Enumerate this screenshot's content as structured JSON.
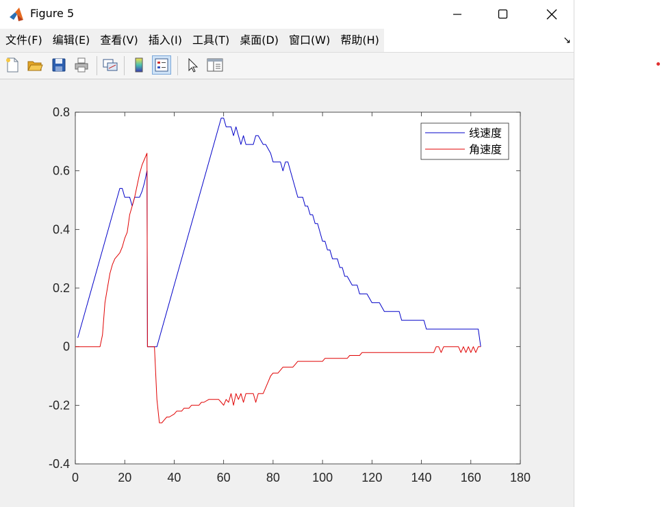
{
  "window": {
    "title": "Figure 5",
    "icon": "matlab-logo-icon",
    "controls": [
      "minimize-icon",
      "maximize-icon",
      "close-icon"
    ]
  },
  "menu": {
    "items": [
      {
        "label": "文件(F)"
      },
      {
        "label": "编辑(E)"
      },
      {
        "label": "查看(V)"
      },
      {
        "label": "插入(I)"
      },
      {
        "label": "工具(T)"
      },
      {
        "label": "桌面(D)"
      },
      {
        "label": "窗口(W)"
      },
      {
        "label": "帮助(H)"
      }
    ],
    "dock_glyph": "↘"
  },
  "toolbar": {
    "buttons": [
      {
        "icon": "new-figure-icon"
      },
      {
        "icon": "open-file-icon"
      },
      {
        "icon": "save-icon"
      },
      {
        "icon": "print-icon"
      },
      {
        "icon": "link-plot-icon"
      },
      {
        "icon": "colorbar-icon"
      },
      {
        "icon": "legend-icon",
        "active": true
      },
      {
        "icon": "pointer-icon"
      },
      {
        "icon": "property-editor-icon"
      }
    ]
  },
  "chart_data": {
    "type": "line",
    "title": "",
    "xlabel": "",
    "ylabel": "",
    "xlim": [
      0,
      180
    ],
    "ylim": [
      -0.4,
      0.8
    ],
    "xticks": [
      0,
      20,
      40,
      60,
      80,
      100,
      120,
      140,
      160,
      180
    ],
    "xtick_labels": [
      "0",
      "20",
      "40",
      "60",
      "80",
      "100",
      "120",
      "140",
      "160",
      "180"
    ],
    "yticks": [
      -0.4,
      -0.2,
      0,
      0.2,
      0.4,
      0.6,
      0.8
    ],
    "ytick_labels": [
      "-0.4",
      "-0.2",
      "0",
      "0.2",
      "0.4",
      "0.6",
      "0.8"
    ],
    "grid": false,
    "legend_position": "top-right",
    "series": [
      {
        "name": "线速度",
        "color": "#0000c8",
        "x": [
          1,
          18,
          19,
          20,
          22,
          23,
          24,
          25,
          26,
          27,
          28,
          29,
          29.2,
          32,
          33,
          59,
          60,
          61,
          62,
          63,
          64,
          65,
          66,
          67,
          68,
          69,
          70,
          72,
          73,
          74,
          76,
          77,
          79,
          80,
          82,
          83,
          84,
          85,
          86,
          87,
          88,
          89,
          90,
          91,
          92,
          93,
          94,
          95,
          96,
          97,
          98,
          99,
          100,
          101,
          102,
          103,
          104,
          105,
          106,
          107,
          108,
          109,
          110,
          112,
          113,
          114,
          115,
          116,
          117,
          118,
          120,
          121,
          122,
          123,
          125,
          126,
          128,
          131,
          132,
          135,
          136,
          141,
          142,
          147,
          148,
          163,
          164
        ],
        "y": [
          0.03,
          0.54,
          0.54,
          0.51,
          0.51,
          0.48,
          0.51,
          0.51,
          0.51,
          0.53,
          0.56,
          0.6,
          0,
          0,
          0,
          0.78,
          0.78,
          0.75,
          0.75,
          0.75,
          0.72,
          0.75,
          0.72,
          0.69,
          0.72,
          0.69,
          0.69,
          0.69,
          0.72,
          0.72,
          0.69,
          0.69,
          0.66,
          0.63,
          0.63,
          0.63,
          0.6,
          0.63,
          0.63,
          0.6,
          0.57,
          0.54,
          0.51,
          0.51,
          0.51,
          0.48,
          0.48,
          0.45,
          0.45,
          0.42,
          0.42,
          0.39,
          0.36,
          0.36,
          0.33,
          0.33,
          0.3,
          0.3,
          0.3,
          0.27,
          0.27,
          0.24,
          0.24,
          0.21,
          0.21,
          0.21,
          0.18,
          0.18,
          0.18,
          0.18,
          0.15,
          0.15,
          0.15,
          0.15,
          0.12,
          0.12,
          0.12,
          0.12,
          0.09,
          0.09,
          0.09,
          0.09,
          0.06,
          0.06,
          0.06,
          0.06,
          0
        ]
      },
      {
        "name": "角速度",
        "color": "#e00000",
        "x": [
          0,
          10,
          11,
          12,
          13,
          14,
          15,
          16,
          17,
          18,
          19,
          20,
          21,
          22,
          23,
          24,
          25,
          26,
          27,
          28,
          29,
          29.2,
          32,
          33,
          34,
          35,
          36,
          37,
          38,
          40,
          41,
          43,
          44,
          46,
          47,
          50,
          51,
          52,
          54,
          55,
          58,
          59,
          60,
          61,
          62,
          63,
          64,
          65,
          66,
          67,
          68,
          69,
          70,
          72,
          73,
          74,
          76,
          77,
          78,
          79,
          80,
          82,
          83,
          84,
          85,
          88,
          89,
          90,
          92,
          93,
          94,
          96,
          97,
          98,
          99,
          100,
          101,
          102,
          103,
          104,
          106,
          107,
          108,
          110,
          111,
          112,
          114,
          115,
          116,
          118,
          119,
          124,
          125,
          130,
          131,
          140,
          141,
          145,
          146,
          147,
          148,
          149,
          150,
          155,
          156,
          157,
          158,
          159,
          160,
          161,
          162,
          163,
          164
        ],
        "y": [
          0,
          0,
          0.04,
          0.15,
          0.2,
          0.25,
          0.28,
          0.3,
          0.31,
          0.32,
          0.34,
          0.37,
          0.39,
          0.45,
          0.48,
          0.51,
          0.55,
          0.59,
          0.62,
          0.64,
          0.66,
          0,
          0,
          -0.18,
          -0.26,
          -0.26,
          -0.25,
          -0.24,
          -0.24,
          -0.23,
          -0.22,
          -0.22,
          -0.21,
          -0.21,
          -0.2,
          -0.2,
          -0.19,
          -0.19,
          -0.18,
          -0.18,
          -0.18,
          -0.19,
          -0.2,
          -0.18,
          -0.19,
          -0.16,
          -0.2,
          -0.16,
          -0.18,
          -0.16,
          -0.19,
          -0.16,
          -0.16,
          -0.16,
          -0.19,
          -0.16,
          -0.16,
          -0.14,
          -0.12,
          -0.1,
          -0.09,
          -0.09,
          -0.08,
          -0.07,
          -0.07,
          -0.07,
          -0.06,
          -0.05,
          -0.05,
          -0.05,
          -0.05,
          -0.05,
          -0.05,
          -0.05,
          -0.05,
          -0.05,
          -0.04,
          -0.04,
          -0.04,
          -0.04,
          -0.04,
          -0.04,
          -0.04,
          -0.04,
          -0.03,
          -0.03,
          -0.03,
          -0.03,
          -0.02,
          -0.02,
          -0.02,
          -0.02,
          -0.02,
          -0.02,
          -0.02,
          -0.02,
          -0.02,
          -0.02,
          0,
          0,
          -0.02,
          0,
          0,
          0,
          -0.02,
          0,
          -0.02,
          0,
          -0.02,
          0,
          -0.02,
          0,
          0
        ]
      }
    ]
  }
}
